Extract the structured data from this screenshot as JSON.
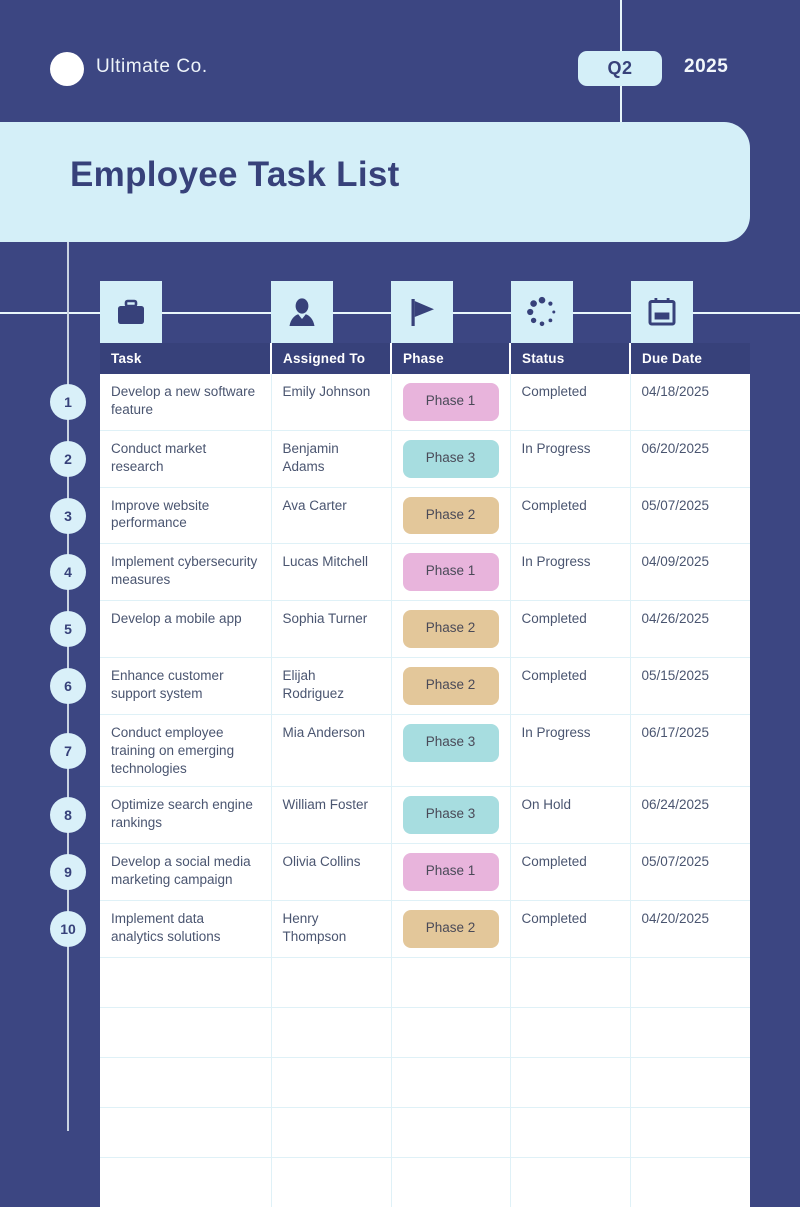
{
  "header": {
    "logo_icon": "circle-logo-icon",
    "brand": "Ultimate Co.",
    "quarter": "Q2",
    "year": "2025"
  },
  "title": "Employee Task List",
  "colors": {
    "background": "#3c4682",
    "banner": "#d4eff8",
    "header_row": "#37417a",
    "phase_1": "#e8b4dc",
    "phase_2": "#e3c79a",
    "phase_3": "#a7dde0",
    "grid_line": "#dff1f7",
    "number_circle": "#d9f0f9"
  },
  "table": {
    "icons": [
      "briefcase-icon",
      "person-icon",
      "flag-icon",
      "spinner-dots-icon",
      "calendar-icon"
    ],
    "columns": [
      "Task",
      "Assigned To",
      "Phase",
      "Status",
      "Due Date"
    ],
    "rows": [
      {
        "n": "1",
        "task": "Develop a new software feature",
        "assigned": "Emily Johnson",
        "phase": "Phase 1",
        "phase_class": "phase-1",
        "status": "Completed",
        "due": "04/18/2025"
      },
      {
        "n": "2",
        "task": "Conduct market research",
        "assigned": "Benjamin Adams",
        "phase": "Phase 3",
        "phase_class": "phase-3",
        "status": "In Progress",
        "due": "06/20/2025"
      },
      {
        "n": "3",
        "task": "Improve website performance",
        "assigned": "Ava Carter",
        "phase": "Phase 2",
        "phase_class": "phase-2",
        "status": "Completed",
        "due": "05/07/2025"
      },
      {
        "n": "4",
        "task": "Implement cybersecurity measures",
        "assigned": "Lucas Mitchell",
        "phase": "Phase 1",
        "phase_class": "phase-1",
        "status": "In Progress",
        "due": "04/09/2025"
      },
      {
        "n": "5",
        "task": "Develop a mobile app",
        "assigned": "Sophia Turner",
        "phase": "Phase 2",
        "phase_class": "phase-2",
        "status": "Completed",
        "due": "04/26/2025"
      },
      {
        "n": "6",
        "task": "Enhance customer support system",
        "assigned": "Elijah Rodriguez",
        "phase": "Phase 2",
        "phase_class": "phase-2",
        "status": "Completed",
        "due": "05/15/2025"
      },
      {
        "n": "7",
        "task": "Conduct employee training on emerging technologies",
        "assigned": "Mia Anderson",
        "phase": "Phase 3",
        "phase_class": "phase-3",
        "status": "In Progress",
        "due": "06/17/2025"
      },
      {
        "n": "8",
        "task": "Optimize search engine rankings",
        "assigned": "William Foster",
        "phase": "Phase 3",
        "phase_class": "phase-3",
        "status": "On Hold",
        "due": "06/24/2025"
      },
      {
        "n": "9",
        "task": "Develop a social media marketing campaign",
        "assigned": "Olivia Collins",
        "phase": "Phase 1",
        "phase_class": "phase-1",
        "status": "Completed",
        "due": "05/07/2025"
      },
      {
        "n": "10",
        "task": "Implement data analytics solutions",
        "assigned": "Henry Thompson",
        "phase": "Phase 2",
        "phase_class": "phase-2",
        "status": "Completed",
        "due": "04/20/2025"
      }
    ],
    "empty_rows": 5
  }
}
